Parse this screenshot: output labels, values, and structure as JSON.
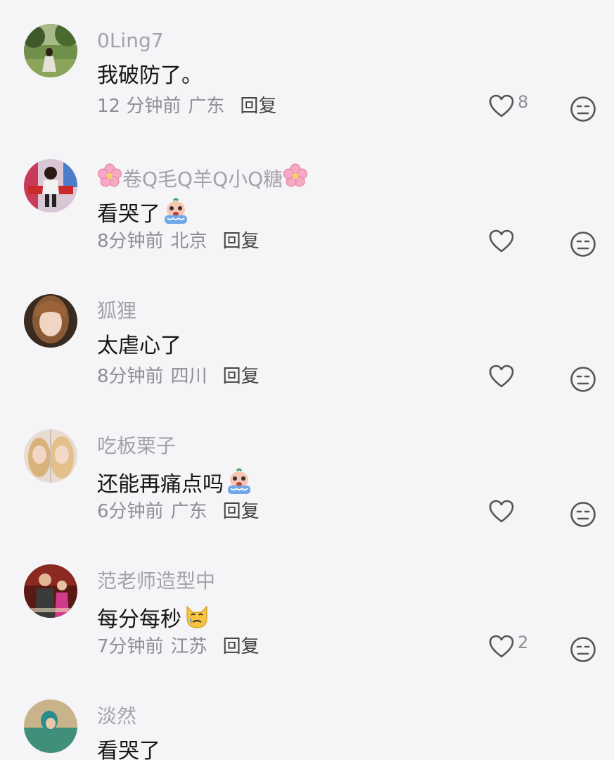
{
  "comments": [
    {
      "username": "0Ling7",
      "text": "我破防了。",
      "time": "12 分钟前",
      "location": "广东",
      "reply": "回复",
      "likes": "8",
      "emoji": ""
    },
    {
      "username": "卷Q毛Q羊Q小Q糖",
      "username_flowers": true,
      "text": "看哭了",
      "emoji": "crying-emoji",
      "time": "8分钟前",
      "location": "北京",
      "reply": "回复",
      "likes": ""
    },
    {
      "username": "狐狸",
      "text": "太虐心了",
      "time": "8分钟前",
      "location": "四川",
      "reply": "回复",
      "likes": "",
      "emoji": ""
    },
    {
      "username": "吃板栗子",
      "text": "还能再痛点吗",
      "emoji": "crying-emoji",
      "time": "6分钟前",
      "location": "广东",
      "reply": "回复",
      "likes": ""
    },
    {
      "username": "范老师造型中",
      "text": "每分每秒",
      "emoji": "crying-cat-emoji",
      "time": "7分钟前",
      "location": "江苏",
      "reply": "回复",
      "likes": "2"
    },
    {
      "username": "淡然",
      "text": "看哭了",
      "time": "",
      "location": "",
      "reply": "",
      "likes": "",
      "emoji": ""
    }
  ],
  "icons": {
    "like": "heart-outline-icon",
    "dislike": "unamused-face-icon"
  },
  "colors": {
    "background": "#f5f5f7",
    "username": "#a3a3a8",
    "meta": "#8e8e93",
    "text": "#161616"
  }
}
